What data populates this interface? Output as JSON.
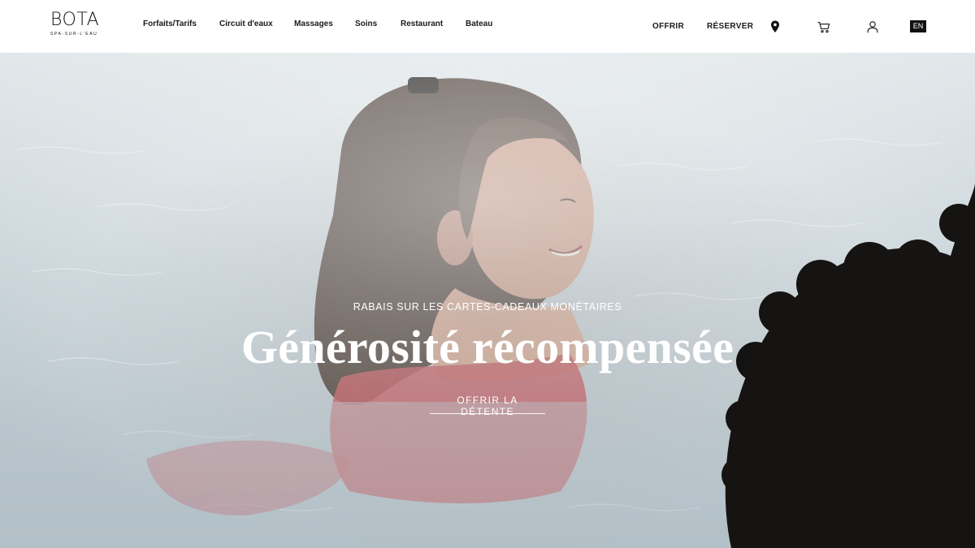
{
  "brand": {
    "name": "BOTA",
    "tagline": "SPA-SUR-L'EAU"
  },
  "nav": {
    "items": [
      {
        "label": "Forfaits/Tarifs"
      },
      {
        "label": "Circuit d'eaux"
      },
      {
        "label": "Massages"
      },
      {
        "label": "Soins"
      },
      {
        "label": "Restaurant"
      },
      {
        "label": "Bateau"
      }
    ],
    "offer_label": "OFFRIR",
    "book_label": "RÉSERVER",
    "language": "EN",
    "icons": [
      "map-pin-icon",
      "cart-icon",
      "user-icon"
    ]
  },
  "hero": {
    "kicker": "RABAIS SUR LES CARTES-CADEAUX MONÉTAIRES",
    "title": "Générosité récompensée",
    "cta_label": "OFFRIR LA DÉTENTE"
  },
  "colors": {
    "text": "#1a1a1a",
    "header_bg": "#ffffff",
    "hero_text": "#ffffff",
    "water": "#b9c6cd",
    "swimsuit": "#c0535a",
    "hair_dark": "#161412"
  }
}
